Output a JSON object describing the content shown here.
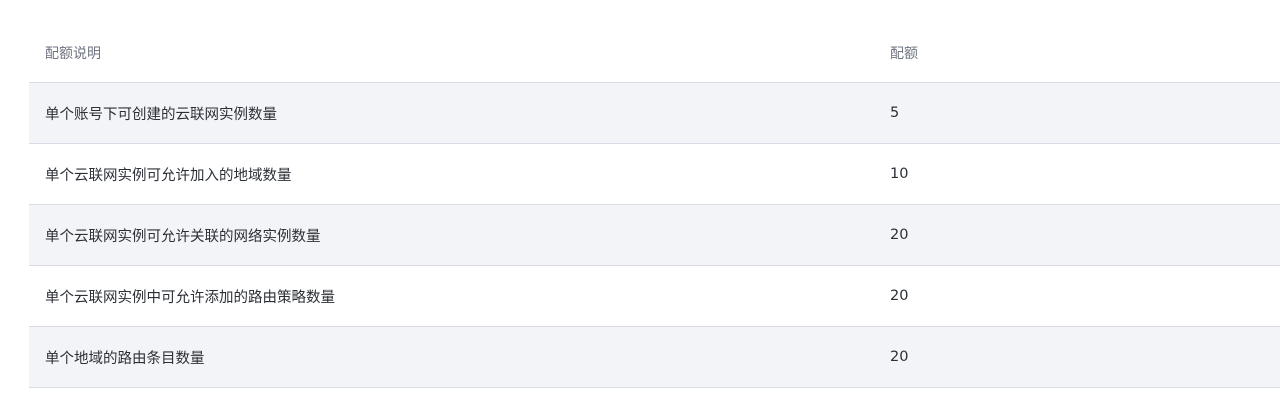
{
  "table": {
    "headers": {
      "description": "配额说明",
      "quota": "配额"
    },
    "rows": [
      {
        "description": "单个账号下可创建的云联网实例数量",
        "quota": "5"
      },
      {
        "description": "单个云联网实例可允许加入的地域数量",
        "quota": "10"
      },
      {
        "description": "单个云联网实例可允许关联的网络实例数量",
        "quota": "20"
      },
      {
        "description": "单个云联网实例中可允许添加的路由策略数量",
        "quota": "20"
      },
      {
        "description": "单个地域的路由条目数量",
        "quota": "20"
      }
    ]
  }
}
